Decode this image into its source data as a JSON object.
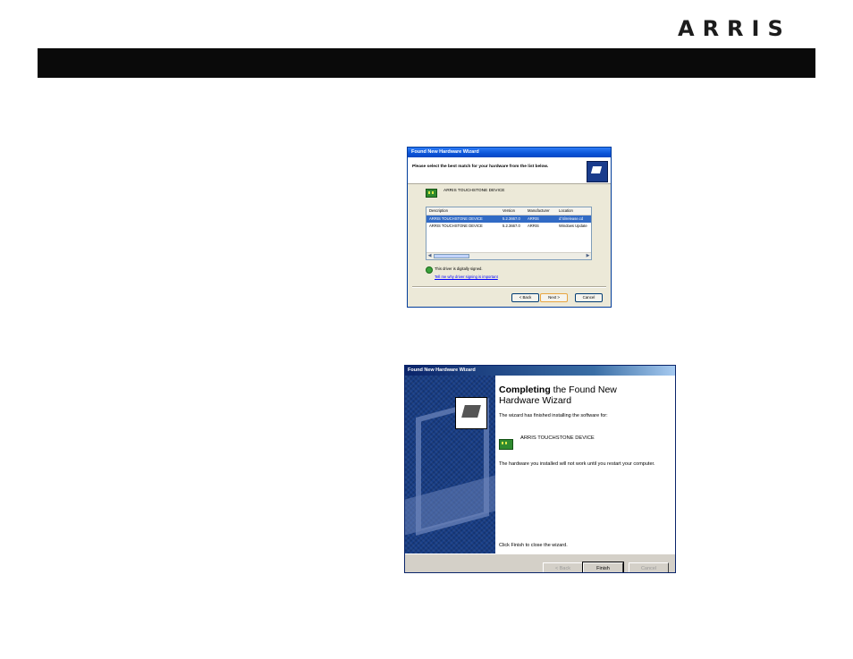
{
  "header": {
    "logo": "ARRIS"
  },
  "wizard1": {
    "title": "Found New Hardware Wizard",
    "prompt": "Please select the best match for your hardware from the list below.",
    "device_name": "ARRIS TOUCHSTONE DEVICE",
    "columns": [
      "Description",
      "Version",
      "Manufacturer",
      "Location"
    ],
    "rows": [
      {
        "description": "ARRIS TOUCHSTONE DEVICE",
        "version": "5.2.3667.0",
        "manufacturer": "ARRIS",
        "location": "d:\\ti\\release.cd",
        "selected": true
      },
      {
        "description": "ARRIS TOUCHSTONE DEVICE",
        "version": "5.2.3667.0",
        "manufacturer": "ARRIS",
        "location": "Windows Update",
        "selected": false
      }
    ],
    "signed_text": "This driver is digitally signed.",
    "signed_link": "Tell me why driver signing is important",
    "buttons": {
      "back": "< Back",
      "next": "Next >",
      "cancel": "Cancel"
    }
  },
  "wizard2": {
    "title": "Found New Hardware Wizard",
    "heading_bold": "Completing",
    "heading_rest": "the Found New Hardware Wizard",
    "finished_text": "The wizard has finished installing the software for:",
    "device_name": "ARRIS TOUCHSTONE DEVICE",
    "restart_text": "The hardware you installed will not work until you restart your computer.",
    "finish_prompt": "Click Finish to close the wizard.",
    "buttons": {
      "back": "< Back",
      "finish": "Finish",
      "cancel": "Cancel"
    }
  }
}
